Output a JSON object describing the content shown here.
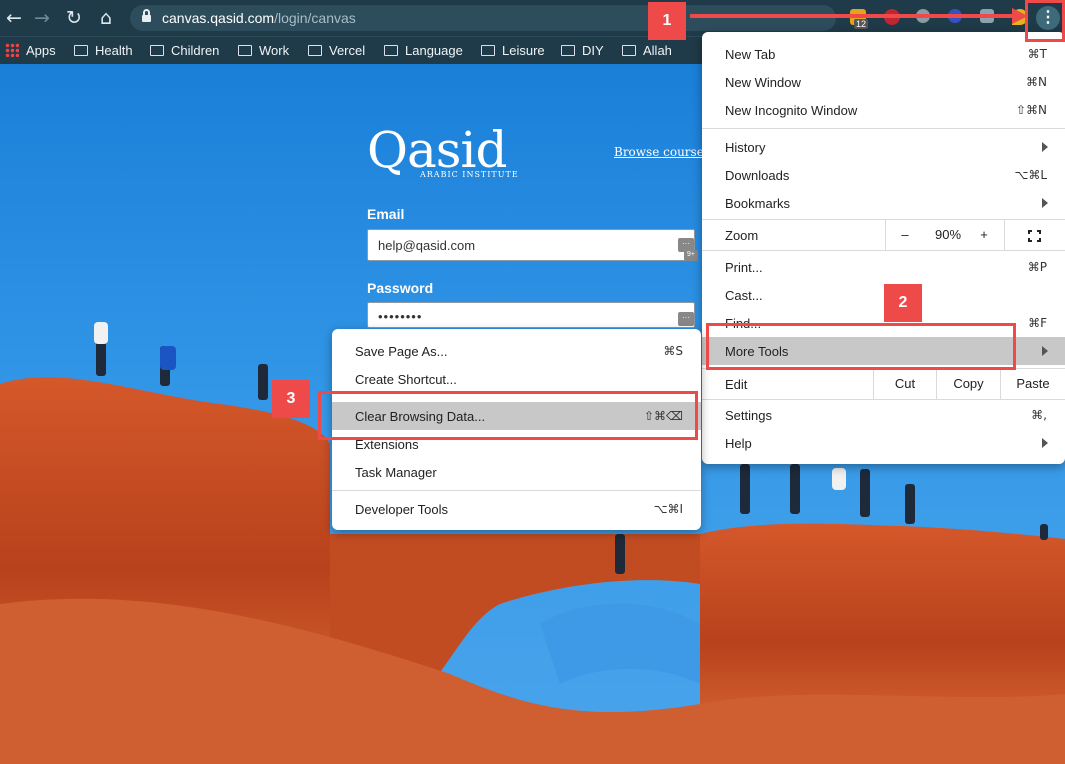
{
  "browser": {
    "url_host": "canvas.qasid.com",
    "url_path": "/login/canvas",
    "extension_badge": "12",
    "menu_icon": "kebab-menu-icon",
    "colors": {
      "chrome": "#1f3a48",
      "annotation": "#ef4a4a"
    }
  },
  "bookmarks": [
    {
      "label": "Apps",
      "icon": "apps-grid-icon"
    },
    {
      "label": "Health",
      "icon": "folder-icon"
    },
    {
      "label": "Children",
      "icon": "folder-icon"
    },
    {
      "label": "Work",
      "icon": "folder-icon"
    },
    {
      "label": "Vercel",
      "icon": "folder-icon"
    },
    {
      "label": "Language",
      "icon": "folder-icon"
    },
    {
      "label": "Leisure",
      "icon": "folder-icon"
    },
    {
      "label": "DIY",
      "icon": "folder-icon"
    },
    {
      "label": "Allah",
      "icon": "folder-icon"
    }
  ],
  "login": {
    "logo": "Qasid",
    "logo_subtitle": "ARABIC INSTITUTE",
    "browse_link": "Browse courses",
    "email_label": "Email",
    "email_value": "help@qasid.com",
    "password_label": "Password",
    "password_value": "••••••••",
    "password_manager_badge": "9+"
  },
  "chrome_menu": {
    "new_tab": {
      "label": "New Tab",
      "shortcut": "⌘T"
    },
    "new_window": {
      "label": "New Window",
      "shortcut": "⌘N"
    },
    "new_incognito": {
      "label": "New Incognito Window",
      "shortcut": "⇧⌘N"
    },
    "history": {
      "label": "History"
    },
    "downloads": {
      "label": "Downloads",
      "shortcut": "⌥⌘L"
    },
    "bookmarks": {
      "label": "Bookmarks"
    },
    "zoom": {
      "label": "Zoom",
      "minus": "–",
      "value": "90%",
      "plus": "+"
    },
    "print": {
      "label": "Print...",
      "shortcut": "⌘P"
    },
    "cast": {
      "label": "Cast..."
    },
    "find": {
      "label": "Find...",
      "shortcut": "⌘F"
    },
    "more_tools": {
      "label": "More Tools"
    },
    "edit": {
      "label": "Edit",
      "cut": "Cut",
      "copy": "Copy",
      "paste": "Paste"
    },
    "settings": {
      "label": "Settings",
      "shortcut": "⌘,"
    },
    "help": {
      "label": "Help"
    }
  },
  "more_tools_menu": {
    "save_page": {
      "label": "Save Page As...",
      "shortcut": "⌘S"
    },
    "create_shortcut": {
      "label": "Create Shortcut..."
    },
    "clear_browsing": {
      "label": "Clear Browsing Data...",
      "shortcut": "⇧⌘⌫"
    },
    "extensions": {
      "label": "Extensions"
    },
    "task_manager": {
      "label": "Task Manager"
    },
    "developer_tools": {
      "label": "Developer Tools",
      "shortcut": "⌥⌘I"
    }
  },
  "annotations": [
    "1",
    "2",
    "3"
  ]
}
